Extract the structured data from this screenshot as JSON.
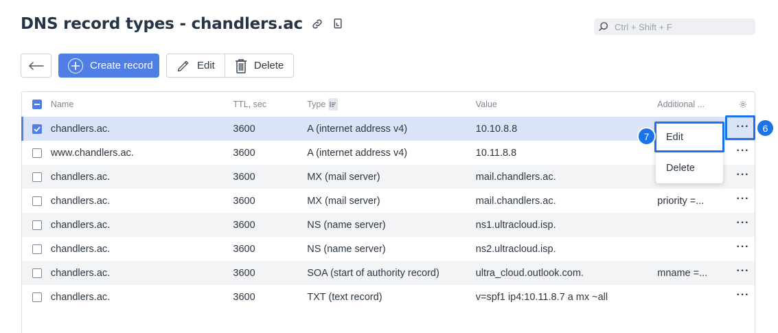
{
  "header": {
    "title": "DNS record types - chandlers.ac",
    "link_icon": "link-icon",
    "copy_icon": "copy-icon"
  },
  "search": {
    "placeholder": "Ctrl + Shift + F",
    "value": ""
  },
  "toolbar": {
    "back_icon": "arrow-left-icon",
    "create_label": "Create record",
    "edit_label": "Edit",
    "delete_label": "Delete"
  },
  "table": {
    "columns": {
      "name": "Name",
      "ttl": "TTL, sec",
      "type": "Type",
      "value": "Value",
      "additional": "Additional ..."
    },
    "rows": [
      {
        "name": "chandlers.ac.",
        "ttl": "3600",
        "type": "A (internet address v4)",
        "value": "10.10.8.8",
        "additional": "",
        "checked": true
      },
      {
        "name": "www.chandlers.ac.",
        "ttl": "3600",
        "type": "A (internet address v4)",
        "value": "10.11.8.8",
        "additional": "",
        "checked": false
      },
      {
        "name": "chandlers.ac.",
        "ttl": "3600",
        "type": "MX (mail server)",
        "value": "mail.chandlers.ac.",
        "additional": "",
        "checked": false
      },
      {
        "name": "chandlers.ac.",
        "ttl": "3600",
        "type": "MX (mail server)",
        "value": "mail.chandlers.ac.",
        "additional": "priority =...",
        "checked": false
      },
      {
        "name": "chandlers.ac.",
        "ttl": "3600",
        "type": "NS (name server)",
        "value": "ns1.ultracloud.isp.",
        "additional": "",
        "checked": false
      },
      {
        "name": "chandlers.ac.",
        "ttl": "3600",
        "type": "NS (name server)",
        "value": "ns2.ultracloud.isp.",
        "additional": "",
        "checked": false
      },
      {
        "name": "chandlers.ac.",
        "ttl": "3600",
        "type": "SOA (start of authority record)",
        "value": "ultra_cloud.outlook.com.",
        "additional": "mname =...",
        "checked": false
      },
      {
        "name": "chandlers.ac.",
        "ttl": "3600",
        "type": "TXT (text record)",
        "value": "v=spf1 ip4:10.11.8.7 a mx ~all",
        "additional": "",
        "checked": false
      }
    ]
  },
  "context_menu": {
    "edit_label": "Edit",
    "delete_label": "Delete"
  },
  "annotations": {
    "badge_dots": "6",
    "badge_edit": "7",
    "highlight_color": "#1a73e8"
  },
  "colors": {
    "accent": "#4f7fe4",
    "selected_row": "#dbe4f7"
  }
}
